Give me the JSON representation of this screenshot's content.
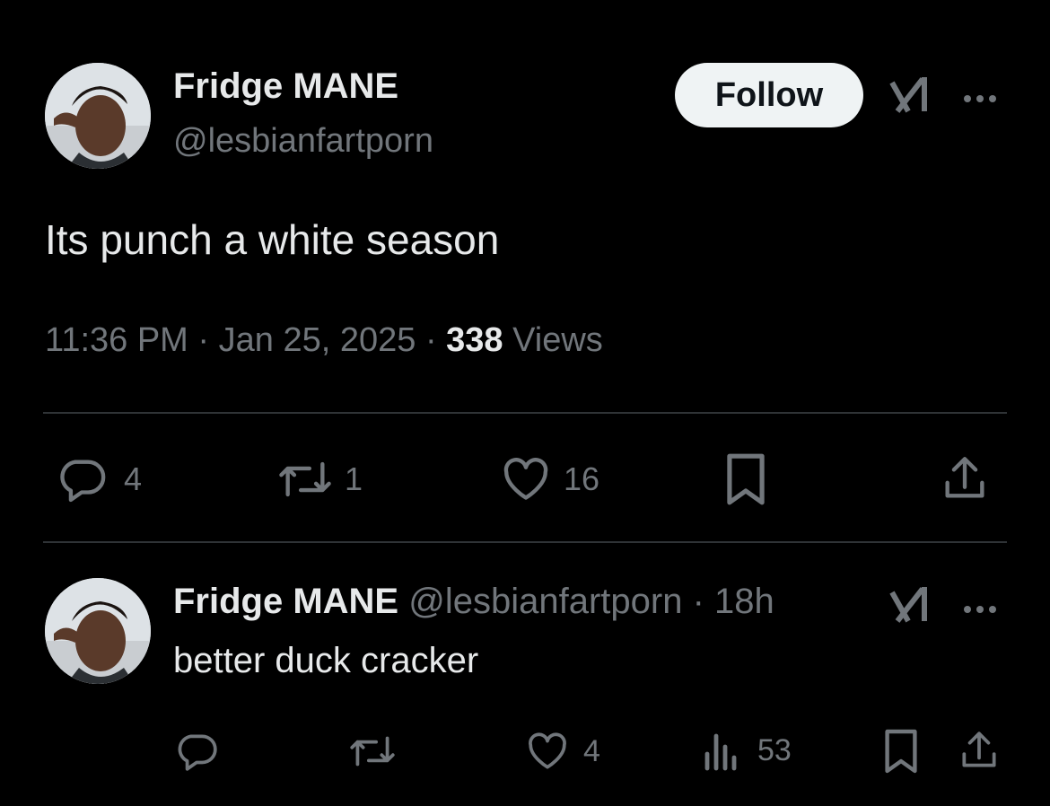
{
  "main_tweet": {
    "author_name": "Fridge MANE",
    "handle": "@lesbianfartporn",
    "follow_label": "Follow",
    "text": "Its punch a white season",
    "time": "11:36 PM",
    "sep1": "·",
    "date": "Jan 25, 2025",
    "sep2": "·",
    "views_count": "338",
    "views_label": "Views",
    "reply_count": "4",
    "repost_count": "1",
    "like_count": "16"
  },
  "reply_tweet": {
    "author_name": "Fridge MANE",
    "handle": "@lesbianfartporn",
    "sep": "·",
    "age": "18h",
    "text": "better duck cracker",
    "like_count": "4",
    "views_count": "53"
  },
  "icons": {
    "grok": "grok-icon",
    "more": "more-icon",
    "reply": "reply-icon",
    "repost": "repost-icon",
    "like": "heart-icon",
    "bookmark": "bookmark-icon",
    "share": "share-icon",
    "analytics": "analytics-icon"
  },
  "colors": {
    "background": "#000000",
    "text": "#e7e9ea",
    "muted": "#71767b",
    "divider": "#2f3336",
    "follow_bg": "#eff3f4"
  }
}
